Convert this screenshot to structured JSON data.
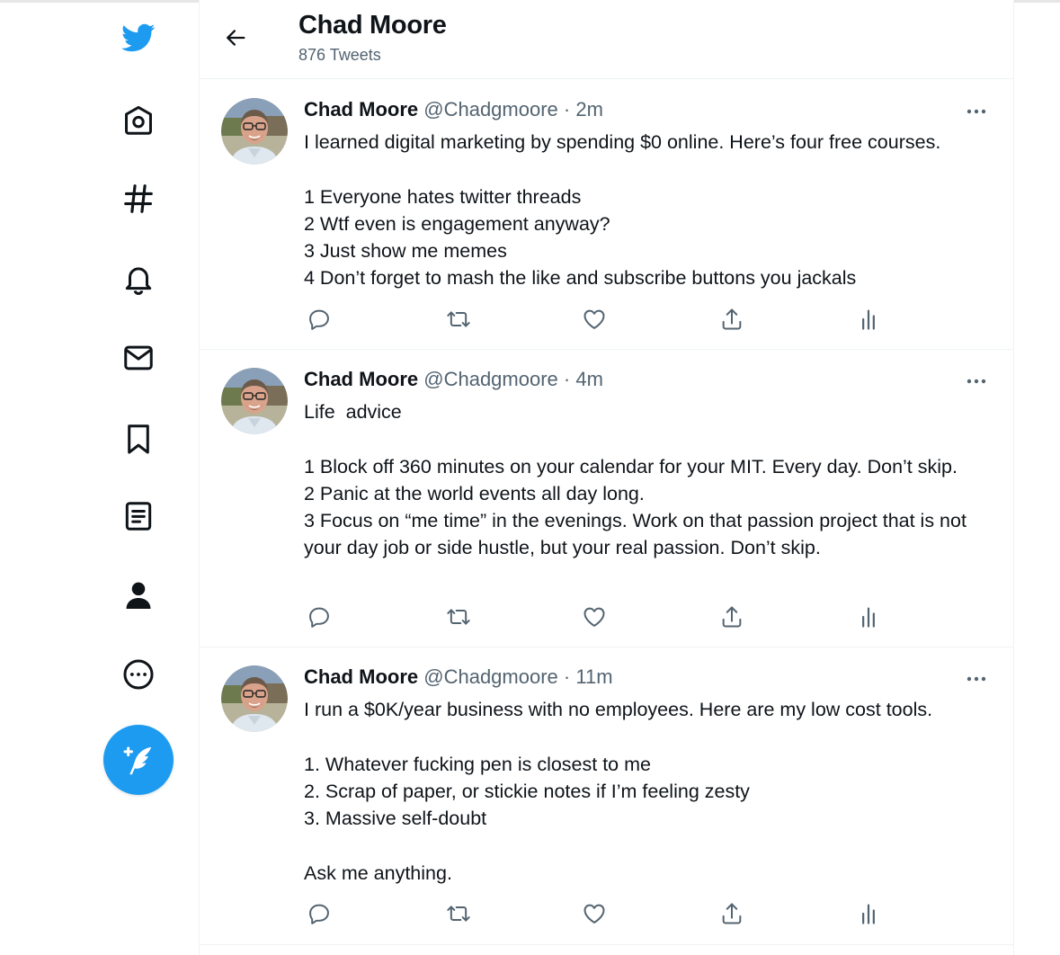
{
  "colors": {
    "accent": "#1d9bf0",
    "secondary_text": "#536471",
    "border": "#eff3f4"
  },
  "nav": {
    "items": [
      {
        "icon": "twitter-logo-icon"
      },
      {
        "icon": "home-icon"
      },
      {
        "icon": "hashtag-icon"
      },
      {
        "icon": "bell-icon"
      },
      {
        "icon": "mail-icon"
      },
      {
        "icon": "bookmark-icon"
      },
      {
        "icon": "list-icon"
      },
      {
        "icon": "profile-icon"
      },
      {
        "icon": "more-circle-icon"
      }
    ],
    "compose_icon": "compose-feather-icon"
  },
  "header": {
    "name": "Chad Moore",
    "tweet_count": "876 Tweets"
  },
  "tweets": [
    {
      "name": "Chad Moore",
      "handle": "@Chadgmoore",
      "dot": "·",
      "time": "2m",
      "lines": [
        "I learned digital marketing by spending $0 online. Here’s four free courses.",
        "",
        "1 Everyone hates twitter threads",
        "2 Wtf even is engagement anyway?",
        "3 Just show me memes",
        "4 Don’t forget to mash the like and subscribe buttons you jackals"
      ]
    },
    {
      "name": "Chad Moore",
      "handle": "@Chadgmoore",
      "dot": "·",
      "time": "4m",
      "lines": [
        "Life  advice",
        "",
        "1 Block off 360 minutes on your calendar for your MIT. Every day. Don’t skip.",
        "2 Panic at the world events all day long.",
        "3 Focus on “me time” in the evenings. Work on that passion project that is not your day job or side hustle, but your real passion. Don’t skip."
      ]
    },
    {
      "name": "Chad Moore",
      "handle": "@Chadgmoore",
      "dot": "·",
      "time": "11m",
      "lines": [
        "I run a $0K/year business with no employees. Here are my low cost tools.",
        "",
        "1. Whatever fucking pen is closest to me",
        "2. Scrap of paper, or stickie notes if I’m feeling zesty",
        "3. Massive self-doubt",
        "",
        "Ask me anything."
      ]
    }
  ]
}
